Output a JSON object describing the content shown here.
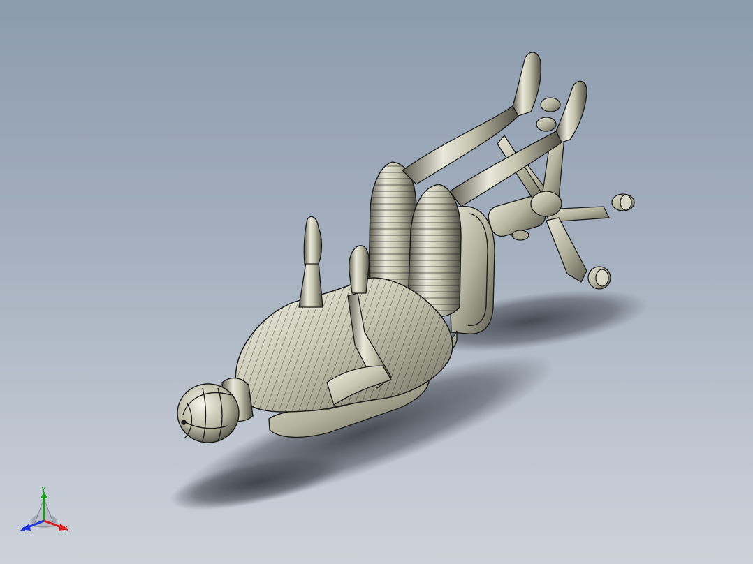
{
  "viewport": {
    "background_top": "#8c9bae",
    "background_bottom": "#cdd2d9",
    "model_fill": "#c9c8b4",
    "edge_color": "#1c1c1c",
    "shadow_color": "#3c4048"
  },
  "triad": {
    "x_label": "X",
    "y_label": "Y",
    "z_label": "Z",
    "x_color": "#d81e1e",
    "y_color": "#1a9a1a",
    "z_color": "#1e35d8"
  }
}
